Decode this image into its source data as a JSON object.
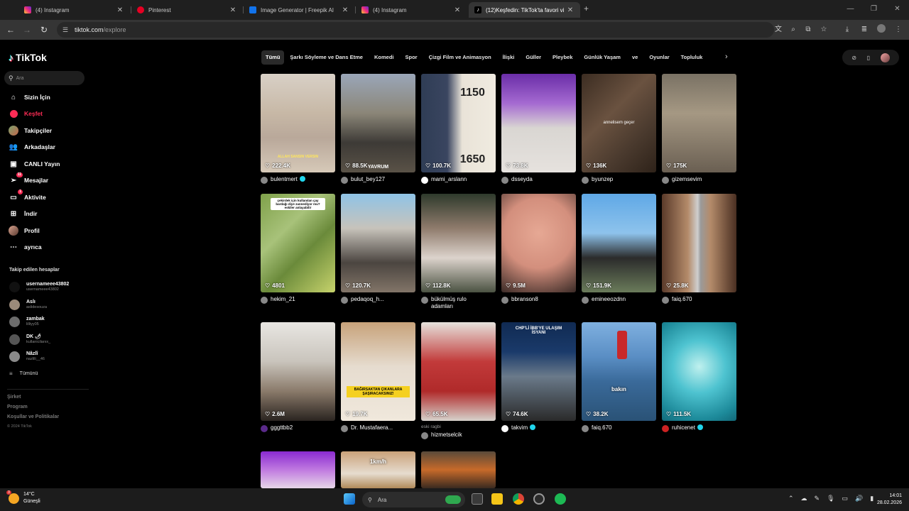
{
  "browser": {
    "tabs": [
      {
        "label": "(4) Instagram",
        "icon": "instagram-icon",
        "color": "#d6249f"
      },
      {
        "label": "Pinterest",
        "icon": "pinterest-icon",
        "color": "#e60023"
      },
      {
        "label": "Image Generator | Freepik AI",
        "icon": "freepik-icon",
        "color": "#1273eb"
      },
      {
        "label": "(4) Instagram",
        "icon": "instagram-icon",
        "color": "#d6249f"
      },
      {
        "label": "(12)Keşfedin: TikTok'ta favori vi",
        "icon": "tiktok-icon",
        "color": "#ffffff"
      }
    ],
    "url_host": "tiktok.com",
    "url_path": "/explore"
  },
  "tiktok": {
    "logo": "TikTok",
    "search_placeholder": "Ara",
    "nav": [
      {
        "label": "Sizin İçin",
        "icon": "home-icon"
      },
      {
        "label": "Keşfet",
        "icon": "compass-icon",
        "active": true
      },
      {
        "label": "Takipçiler",
        "icon": "following-avatar-icon"
      },
      {
        "label": "Arkadaşlar",
        "icon": "friends-icon"
      },
      {
        "label": "CANLI Yayın",
        "icon": "live-icon"
      },
      {
        "label": "Mesajlar",
        "icon": "messages-icon",
        "badge": "11"
      },
      {
        "label": "Aktivite",
        "icon": "activity-icon",
        "badge": "1"
      },
      {
        "label": "İndir",
        "icon": "download-icon"
      },
      {
        "label": "Profil",
        "icon": "profile-avatar-icon"
      },
      {
        "label": "ayrıca",
        "icon": "more-icon"
      }
    ],
    "following_title": "Takip edilen hesaplar",
    "following": [
      {
        "name": "usernameee43802",
        "handle": "usernameee43802"
      },
      {
        "name": "Aslı",
        "handle": "aslidesouza"
      },
      {
        "name": "zambak",
        "handle": "lilliyy05"
      },
      {
        "name": "DK 🌶",
        "handle": "kullanicilarxx_"
      },
      {
        "name": "Nâzlî",
        "handle": "nazlili__46"
      }
    ],
    "see_all": "Tümünü",
    "footer_links": [
      "Şirket",
      "Program",
      "Koşullar ve Politikalar"
    ],
    "copyright": "© 2024 TikTok",
    "categories": [
      "Tümü",
      "Şarkı Söyleme ve Dans Etme",
      "Komedi",
      "Spor",
      "Çizgi Film ve Animasyon",
      "İlişki",
      "Güller",
      "Pleybek",
      "Günlük Yaşam",
      "ve",
      "Oyunlar",
      "Topluluk"
    ],
    "videos": [
      {
        "likes": "222.4K",
        "author": "bulentmert",
        "verified": true
      },
      {
        "likes": "88.5K",
        "author": "bulut_bey127"
      },
      {
        "likes": "100.7K",
        "author": "mami_arslann"
      },
      {
        "likes": "73.8K",
        "author": "dsseyda"
      },
      {
        "likes": "136K",
        "author": "byunzep"
      },
      {
        "likes": "175K",
        "author": "gizemsevim"
      },
      {
        "likes": "4801",
        "author": "hekim_21"
      },
      {
        "likes": "120.7K",
        "author": "pedaqoq_h..."
      },
      {
        "likes": "112.8K",
        "author": "bükülmüş rulo adamları"
      },
      {
        "likes": "9.5M",
        "author": "bbranson8"
      },
      {
        "likes": "151.9K",
        "author": "emineeozdnn"
      },
      {
        "likes": "25.8K",
        "author": "faiq.670"
      },
      {
        "likes": "2.6M",
        "author": "gggttbb2"
      },
      {
        "likes": "19.7K",
        "author": "Dr. Mustafaera..."
      },
      {
        "likes": "65.5K",
        "author": "hizmetselcik",
        "caption": "eski ragbi"
      },
      {
        "likes": "74.6K",
        "author": "takvim",
        "verified": true
      },
      {
        "likes": "38.2K",
        "author": "faiq.670"
      },
      {
        "likes": "111.5K",
        "author": "ruhicenet",
        "verified": true
      }
    ],
    "overlays": {
      "v1": "ALLAH SANSIN VERSIN",
      "v2": "YAVRUM",
      "v3a": "1150",
      "v3b": "1650",
      "v5": "annelisem geçer",
      "v7": "çekirdek için kullanılan çay bardağı diye zannediyor mu? eskiler anlayabilir",
      "v14": "BAĞIRSAKTAN ÇIKANLARA ŞAŞIRACAKSINIZ!",
      "v16": "CHP'Lİ İBB'YE ULAŞIM İSYANI",
      "v17": "bakın",
      "v20": "1km/h"
    }
  },
  "taskbar": {
    "temp": "14°C",
    "weather": "Güneşli",
    "weather_badge": "3",
    "search": "Ara",
    "time": "14:01",
    "date": "28.02.2026"
  }
}
